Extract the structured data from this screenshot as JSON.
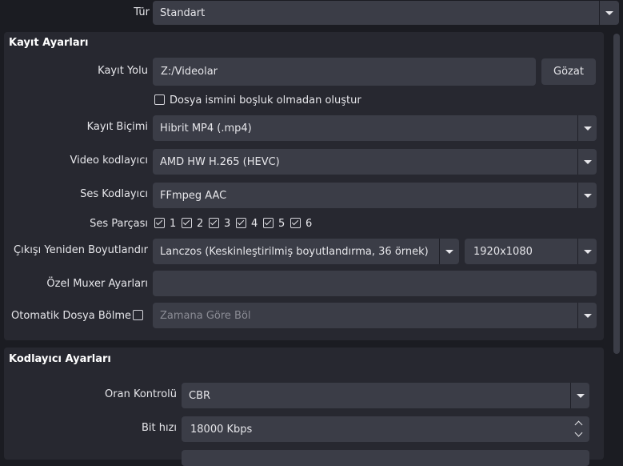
{
  "top": {
    "type_label": "Tür",
    "type_value": "Standart"
  },
  "recording": {
    "title": "Kayıt Ayarları",
    "path_label": "Kayıt Yolu",
    "path_value": "Z:/Videolar",
    "browse_button": "Gözat",
    "no_space_label": "Dosya ismini boşluk olmadan oluştur",
    "no_space_checked": false,
    "format_label": "Kayıt Biçimi",
    "format_value": "Hibrit MP4 (.mp4)",
    "video_encoder_label": "Video kodlayıcı",
    "video_encoder_value": "AMD HW H.265 (HEVC)",
    "audio_encoder_label": "Ses Kodlayıcı",
    "audio_encoder_value": "FFmpeg AAC",
    "audio_track_label": "Ses Parçası",
    "audio_tracks": [
      {
        "label": "1",
        "checked": true
      },
      {
        "label": "2",
        "checked": true
      },
      {
        "label": "3",
        "checked": true
      },
      {
        "label": "4",
        "checked": true
      },
      {
        "label": "5",
        "checked": true
      },
      {
        "label": "6",
        "checked": true
      }
    ],
    "rescale_label": "Çıkışı Yeniden Boyutlandır",
    "rescale_filter_value": "Lanczos (Keskinleştirilmiş boyutlandırma, 36 örnek)",
    "rescale_resolution_value": "1920x1080",
    "muxer_label": "Özel Muxer Ayarları",
    "muxer_value": "",
    "auto_split_label": "Otomatik Dosya Bölme",
    "auto_split_checked": false,
    "auto_split_value": "Zamana Göre Böl"
  },
  "encoder": {
    "title": "Kodlayıcı Ayarları",
    "rate_control_label": "Oran Kontrolü",
    "rate_control_value": "CBR",
    "bitrate_label": "Bit hızı",
    "bitrate_value": "18000 Kbps"
  },
  "colors": {
    "background": "#1b1c22",
    "panel": "#272830",
    "field": "#3b3d47",
    "text": "#e6e6ea"
  }
}
